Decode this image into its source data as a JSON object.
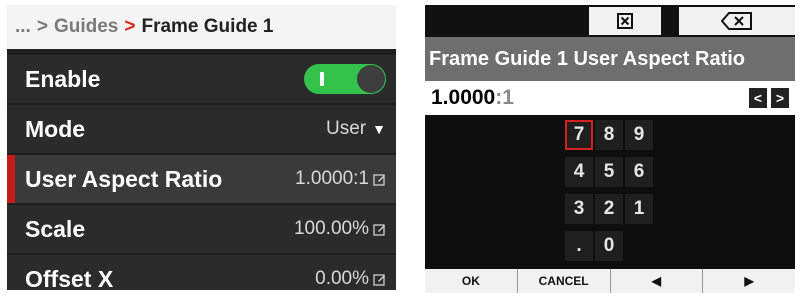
{
  "left": {
    "breadcrumb": {
      "ellipsis": "...",
      "separator": ">",
      "parent": "Guides",
      "arrow": ">",
      "current": "Frame Guide 1"
    },
    "rows": [
      {
        "label": "Enable",
        "toggle_on": true
      },
      {
        "label": "Mode",
        "value": "User"
      },
      {
        "label": "User Aspect Ratio",
        "value": "1.0000:1",
        "selected": true
      },
      {
        "label": "Scale",
        "value": "100.00%"
      },
      {
        "label": "Offset X",
        "value": "0.00%"
      }
    ],
    "accent_color": "#c41c1c",
    "toggle_color": "#33c24a"
  },
  "right": {
    "top_keys": [
      {
        "name": "blank-key",
        "icon": ""
      },
      {
        "name": "clear-key",
        "icon": "close-box-icon"
      },
      {
        "name": "backspace-key",
        "icon": "backspace-icon"
      }
    ],
    "title": "Frame Guide 1 User Aspect Ratio",
    "entry": {
      "value": "1.0000",
      "suffix": ":1"
    },
    "nav": {
      "left": "<",
      "right": ">"
    },
    "keypad": [
      [
        "7",
        "8",
        "9"
      ],
      [
        "4",
        "5",
        "6"
      ],
      [
        "3",
        "2",
        "1"
      ],
      [
        ".",
        "0"
      ]
    ],
    "focused_key": "7",
    "bottom_buttons": [
      {
        "label": "OK"
      },
      {
        "label": "CANCEL"
      },
      {
        "label": "◀"
      },
      {
        "label": "▶"
      }
    ]
  }
}
